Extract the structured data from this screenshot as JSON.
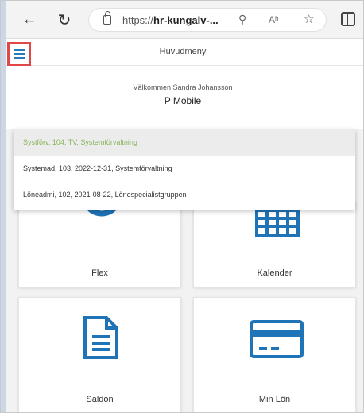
{
  "browser": {
    "url_prefix": "https://",
    "url_host": "hr-kungalv-...",
    "read_aloud_label": "Aʰ"
  },
  "app": {
    "title": "Huvudmeny",
    "welcome": "Välkommen Sandra Johansson",
    "product": "P Mobile"
  },
  "dropdown": {
    "items": [
      "Systförv, 104, TV, Systemförvaltning",
      "Systemad, 103, 2022-12-31, Systemförvaltning",
      "Löneadmi, 102, 2021-08-22, Lönespecialistgruppen"
    ]
  },
  "tiles": [
    {
      "label": "Flex",
      "icon": "clock-icon"
    },
    {
      "label": "Kalender",
      "icon": "calendar-icon"
    },
    {
      "label": "Saldon",
      "icon": "document-icon"
    },
    {
      "label": "Min Lön",
      "icon": "credit-card-icon"
    }
  ],
  "colors": {
    "icon_blue": "#1f73b7",
    "menu_highlight": "#e04848",
    "active_item": "#8ab35b"
  }
}
